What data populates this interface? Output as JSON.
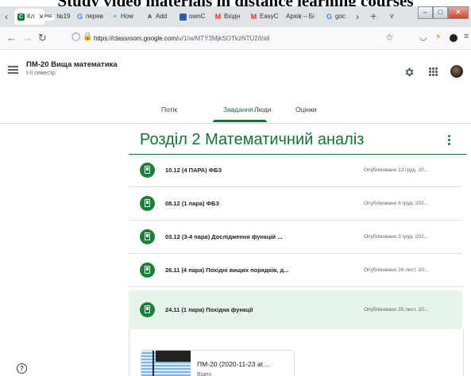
{
  "caption": "Study video materials in distance learning courses",
  "browser": {
    "tabs": [
      {
        "label": "Кл",
        "favicon": "C",
        "color": "#137333",
        "active": true
      },
      {
        "label": "№19",
        "favicon": "PKF",
        "color": "#444444"
      },
      {
        "label": "перев",
        "favicon": "G",
        "color": "#4285f4"
      },
      {
        "label": "How",
        "favicon": "≡",
        "color": "#3b82f6"
      },
      {
        "label": "Add",
        "favicon": "A",
        "color": "#333333"
      },
      {
        "label": "ownC",
        "favicon": "■",
        "color": "#2a5fa8"
      },
      {
        "label": "Вхідн",
        "favicon": "M",
        "color": "#d93025"
      },
      {
        "label": "EasyC",
        "favicon": "M",
        "color": "#d93025"
      },
      {
        "label": "Архів – Бі",
        "favicon": "",
        "color": "#888888"
      },
      {
        "label": "goc",
        "favicon": "G",
        "color": "#4285f4"
      }
    ],
    "url_prefix": "https://classroom.google.com/",
    "url_rest": "u/1/w/MTY3MjkSOTkzNTU2/t/all"
  },
  "course": {
    "title": "ПМ-20 Вища математика",
    "subtitle": "I-II семестр"
  },
  "nav_tabs": [
    {
      "label": "Потік"
    },
    {
      "label": "Завдання",
      "active": true
    },
    {
      "label": "Люди"
    },
    {
      "label": "Оцінки"
    }
  ],
  "section": {
    "title": "Розділ 2 Математичний аналіз"
  },
  "items": [
    {
      "title": "10.12 (4 ПАРА) ФБЗ",
      "meta": "Опубліковано 12 груд. 20..."
    },
    {
      "title": "08.12 (1 пара) ФБЗ",
      "meta": "Опубліковано 8 груд. 202..."
    },
    {
      "title": "03.12 (3-4 пара) Дослідження функцій ...",
      "meta": "Опубліковано 3 груд. 202..."
    },
    {
      "title": "26.11 (4 пара) Похідні вищих порядків, д...",
      "meta": "Опубліковано 26 лист. 20..."
    },
    {
      "title": "24.11 (1 пара) Похідна функції",
      "meta": "Опубліковано 25 лист. 20..."
    }
  ],
  "attachment": {
    "title": "ПМ-20 (2020-11-23 at ...",
    "type": "Відео"
  },
  "help_label": "?"
}
